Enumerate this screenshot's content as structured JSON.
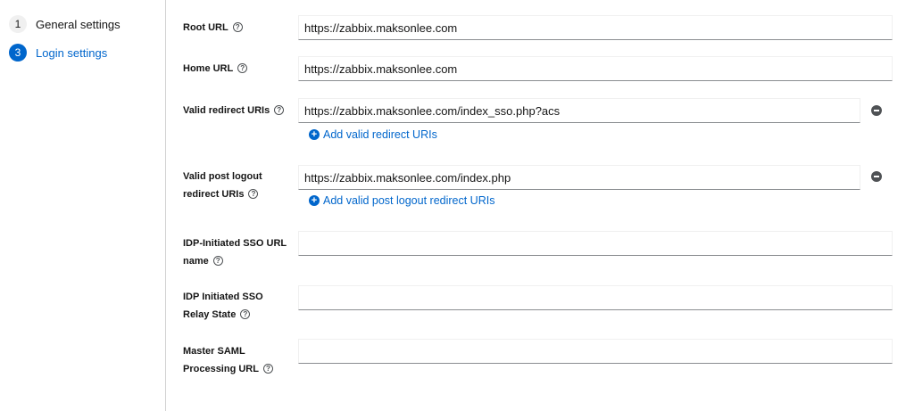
{
  "wizard": {
    "steps": [
      {
        "number": "1",
        "label": "General settings"
      },
      {
        "number": "3",
        "label": "Login settings"
      }
    ]
  },
  "help_glyph": "?",
  "form": {
    "root_url": {
      "label": "Root URL",
      "value": "https://zabbix.maksonlee.com"
    },
    "home_url": {
      "label": "Home URL",
      "value": "https://zabbix.maksonlee.com"
    },
    "valid_redirect": {
      "label": "Valid redirect URIs",
      "value": "https://zabbix.maksonlee.com/index_sso.php?acs",
      "add_label": "Add valid redirect URIs"
    },
    "post_logout": {
      "label_line1": "Valid post logout",
      "label_line2": "redirect URIs",
      "value": "https://zabbix.maksonlee.com/index.php",
      "add_label": "Add valid post logout redirect URIs"
    },
    "idp_sso_url": {
      "label_line1": "IDP-Initiated SSO URL",
      "label_line2": "name",
      "value": ""
    },
    "idp_relay": {
      "label_line1": "IDP Initiated SSO",
      "label_line2": "Relay State",
      "value": ""
    },
    "master_saml": {
      "label_line1": "Master SAML",
      "label_line2": "Processing URL",
      "value": ""
    }
  },
  "colors": {
    "accent": "#0066cc",
    "text": "#151515",
    "border": "#8a8d90",
    "icon": "#4f5255"
  },
  "icons": [
    "help-icon",
    "minus-circle-icon",
    "plus-circle-icon"
  ]
}
